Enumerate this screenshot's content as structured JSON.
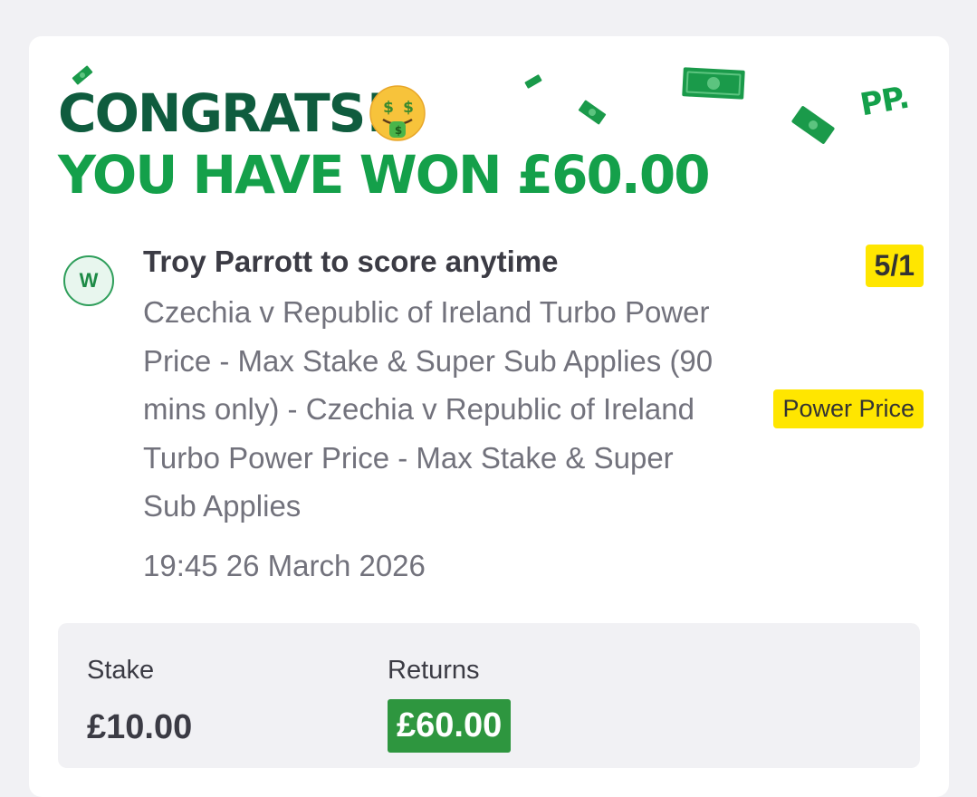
{
  "celebration": {
    "line1": "CONGRATS!",
    "line2": "YOU HAVE WON £60.00",
    "emoji_icon": "money-mouth-face-icon",
    "brand_mark": "PP."
  },
  "bet": {
    "status": "W",
    "selection": "Troy Parrott to score anytime",
    "market": "Czechia v Republic of Ireland Turbo Power Price - Max Stake & Super Sub Applies (90 mins only) - Czechia v Republic of Ireland Turbo Power Price - Max Stake & Super Sub Applies",
    "event_time": "19:45 26 March 2026",
    "odds": "5/1",
    "badge": "Power Price"
  },
  "summary": {
    "stake_label": "Stake",
    "stake_value": "£10.00",
    "returns_label": "Returns",
    "returns_value": "£60.00"
  },
  "colors": {
    "dark_green": "#0f5c3e",
    "bright_green": "#14a04a",
    "badge_yellow": "#ffe600",
    "returns_green": "#2e963f"
  }
}
